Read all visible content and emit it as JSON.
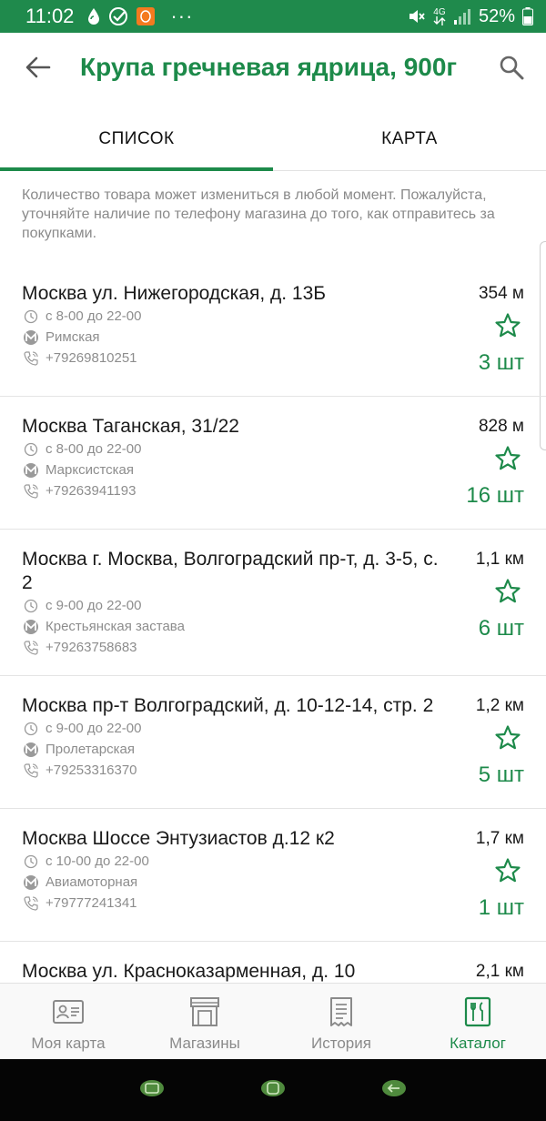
{
  "status_bar": {
    "time": "11:02",
    "dots": "···",
    "battery_percent": "52%",
    "network": "4G"
  },
  "app_bar": {
    "title": "Крупа гречневая ядрица, 900г"
  },
  "tabs": [
    {
      "label": "СПИСОК",
      "active": true
    },
    {
      "label": "КАРТА",
      "active": false
    }
  ],
  "notice": "Количество товара может измениться в любой момент. Пожалуйста, уточняйте наличие по телефону магазина до того, как отправитесь за покупками.",
  "stores": [
    {
      "address": "Москва ул. Нижегородская, д. 13Б",
      "hours": "с 8-00 до 22-00",
      "metro": "Римская",
      "phone": "+79269810251",
      "distance": "354 м",
      "quantity": "3 шт"
    },
    {
      "address": "Москва Таганская, 31/22",
      "hours": "с 8-00 до 22-00",
      "metro": "Марксистская",
      "phone": "+79263941193",
      "distance": "828 м",
      "quantity": "16 шт"
    },
    {
      "address": "Москва г. Москва, Волгоградский пр-т, д. 3-5, с. 2",
      "hours": "с 9-00 до 22-00",
      "metro": "Крестьянская застава",
      "phone": "+79263758683",
      "distance": "1,1 км",
      "quantity": "6 шт"
    },
    {
      "address": "Москва пр-т Волгоградский, д. 10-12-14, стр. 2",
      "hours": "с 9-00 до 22-00",
      "metro": "Пролетарская",
      "phone": "+79253316370",
      "distance": "1,2 км",
      "quantity": "5 шт"
    },
    {
      "address": "Москва Шоссе Энтузиастов д.12 к2",
      "hours": "с 10-00 до 22-00",
      "metro": "Авиамоторная",
      "phone": "+79777241341",
      "distance": "1,7 км",
      "quantity": "1 шт"
    },
    {
      "address": "Москва ул. Красноказарменная, д. 10",
      "hours": "",
      "metro": "",
      "phone": "",
      "distance": "2,1 км",
      "quantity": ""
    }
  ],
  "bottom_nav": [
    {
      "label": "Моя карта",
      "icon": "id-card-icon",
      "active": false
    },
    {
      "label": "Магазины",
      "icon": "store-icon",
      "active": false
    },
    {
      "label": "История",
      "icon": "receipt-icon",
      "active": false
    },
    {
      "label": "Каталог",
      "icon": "catalog-icon",
      "active": true
    }
  ],
  "colors": {
    "brand_green": "#1d8a4a",
    "status_bar": "#1f8a4c",
    "muted_text": "#8d8d8d"
  }
}
